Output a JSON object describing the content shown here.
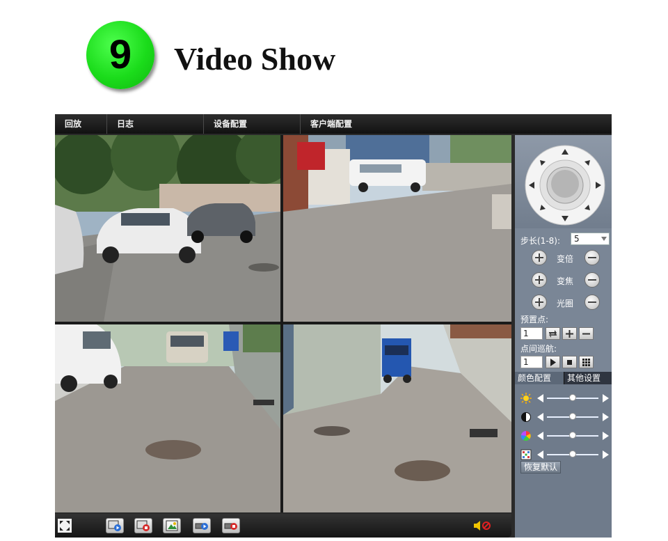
{
  "banner": {
    "badge_number": "9",
    "title": "Video Show"
  },
  "menu": {
    "items": [
      {
        "label": "回放"
      },
      {
        "label": "日志"
      },
      {
        "label": "设备配置"
      },
      {
        "label": "客户端配置"
      }
    ]
  },
  "ptz": {
    "step_label": "步长(1-8):",
    "step_value": "5",
    "zoom_label": "变倍",
    "focus_label": "变焦",
    "iris_label": "光圈",
    "preset_label": "预置点:",
    "preset_value": "1",
    "cruise_label": "点间巡航:",
    "cruise_value": "1"
  },
  "tabs": {
    "color": "颜色配置",
    "other": "其他设置"
  },
  "color_settings": {
    "sliders": [
      {
        "name": "brightness",
        "icon": "sun-icon",
        "level": 0.5
      },
      {
        "name": "contrast",
        "icon": "contrast-icon",
        "level": 0.5
      },
      {
        "name": "saturation",
        "icon": "color-wheel-icon",
        "level": 0.5
      },
      {
        "name": "hue",
        "icon": "grid-icon",
        "level": 0.5
      }
    ],
    "reset_label": "恢复默认"
  },
  "colors": {
    "accent_green": "#1bdc1b",
    "panel": "#7a8696",
    "menubar": "#1e1e1e"
  }
}
